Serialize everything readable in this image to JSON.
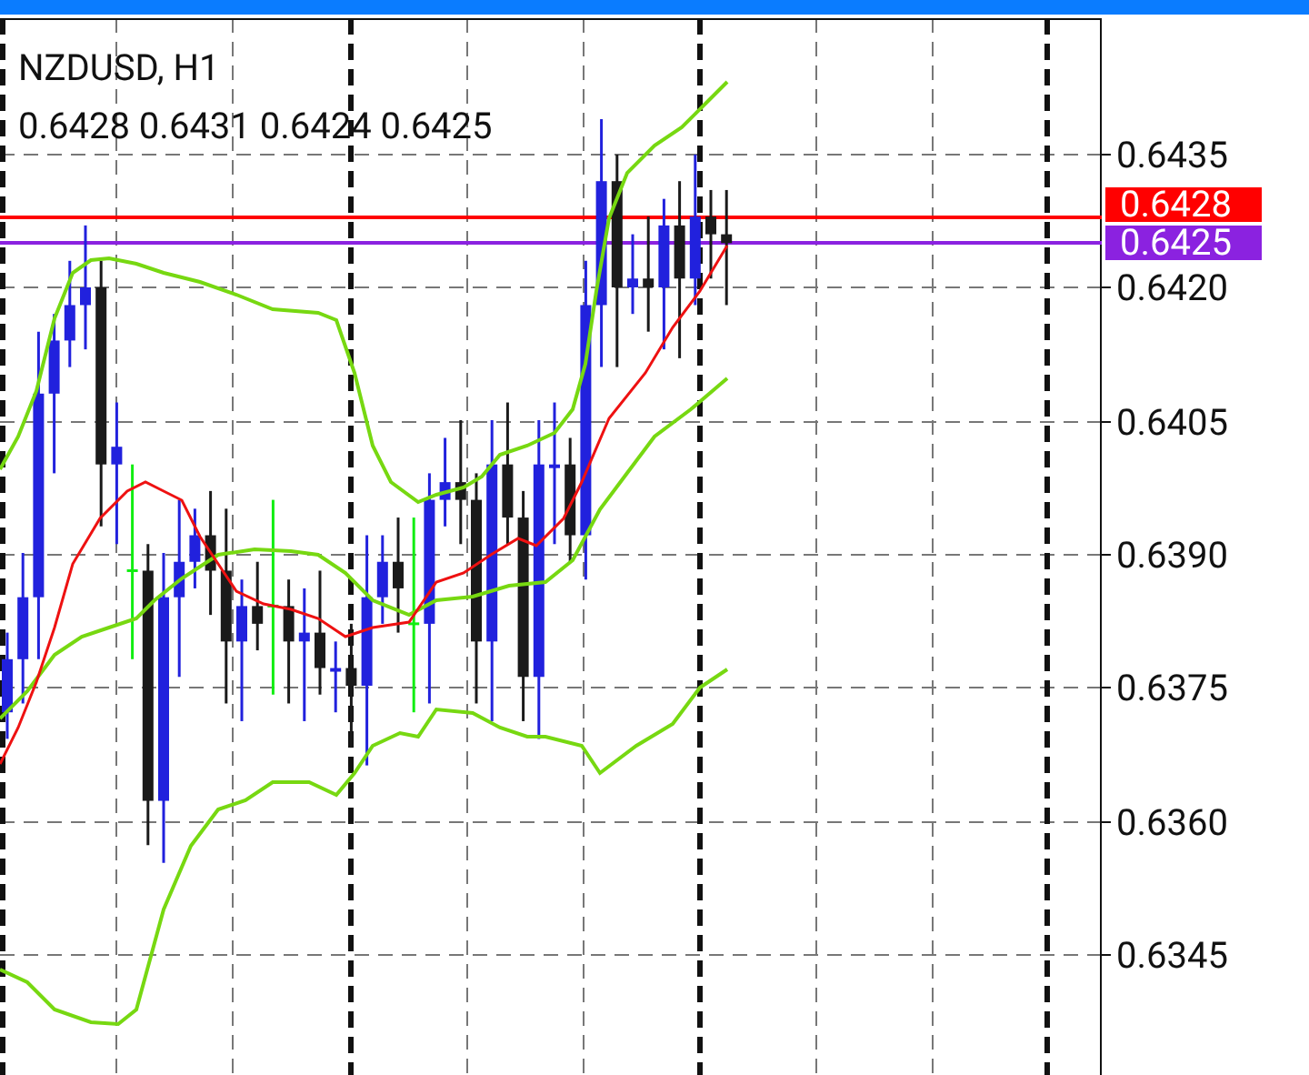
{
  "chart": {
    "symbol_title": "NZDUSD, H1",
    "ohlc_values": "0.6428 0.6431 0.6424 0.6425",
    "price_axis": {
      "labels": [
        "0.6435",
        "0.6420",
        "0.6405",
        "0.6390",
        "0.6375",
        "0.6360",
        "0.6345"
      ]
    },
    "price_tags": [
      {
        "text": "0.6428",
        "color": "#ff0000"
      },
      {
        "text": "0.6425",
        "color": "#8b22e0"
      }
    ]
  }
}
